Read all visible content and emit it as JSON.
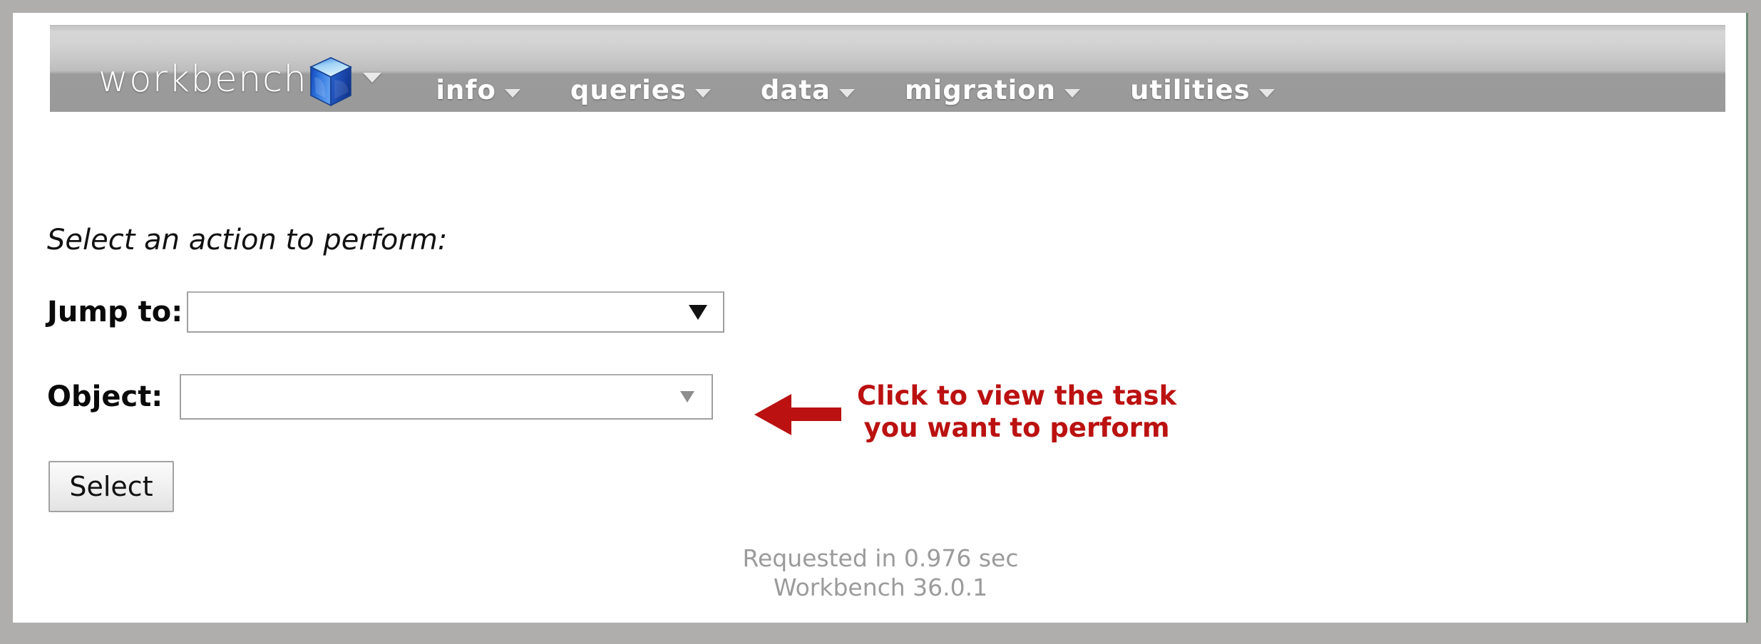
{
  "app": {
    "brand_name": "workbench",
    "brand_icon": "blue-cube-icon",
    "brand_caret_icon": "chevron-down-icon"
  },
  "nav": {
    "items": [
      {
        "label": "info",
        "caret_icon": "chevron-down-icon"
      },
      {
        "label": "queries",
        "caret_icon": "chevron-down-icon"
      },
      {
        "label": "data",
        "caret_icon": "chevron-down-icon"
      },
      {
        "label": "migration",
        "caret_icon": "chevron-down-icon"
      },
      {
        "label": "utilities",
        "caret_icon": "chevron-down-icon"
      }
    ]
  },
  "main": {
    "prompt": "Select an action to perform:",
    "fields": [
      {
        "label": "Jump to:",
        "value": "",
        "placeholder": "",
        "arrow_icon": "triangle-down-icon",
        "enabled": true
      },
      {
        "label": "Object:",
        "value": "",
        "placeholder": "",
        "arrow_icon": "triangle-down-icon",
        "enabled": false
      }
    ],
    "submit_label": "Select"
  },
  "annotation": {
    "arrow_icon": "arrow-left-icon",
    "line1": "Click to view the task",
    "line2": "you want to perform",
    "color": "#bb1111"
  },
  "footer": {
    "request_time": "Requested in 0.976 sec",
    "version": "Workbench 36.0.1"
  },
  "colors": {
    "navbar_top": "#d6d6d6",
    "navbar_bottom": "#9a9a9a",
    "nav_text": "#ffffff",
    "annotation_red": "#bb1111",
    "footer_text": "#9b9b9b",
    "cube_blue": "#1f63d8",
    "frame_gray": "#b0aeac"
  }
}
